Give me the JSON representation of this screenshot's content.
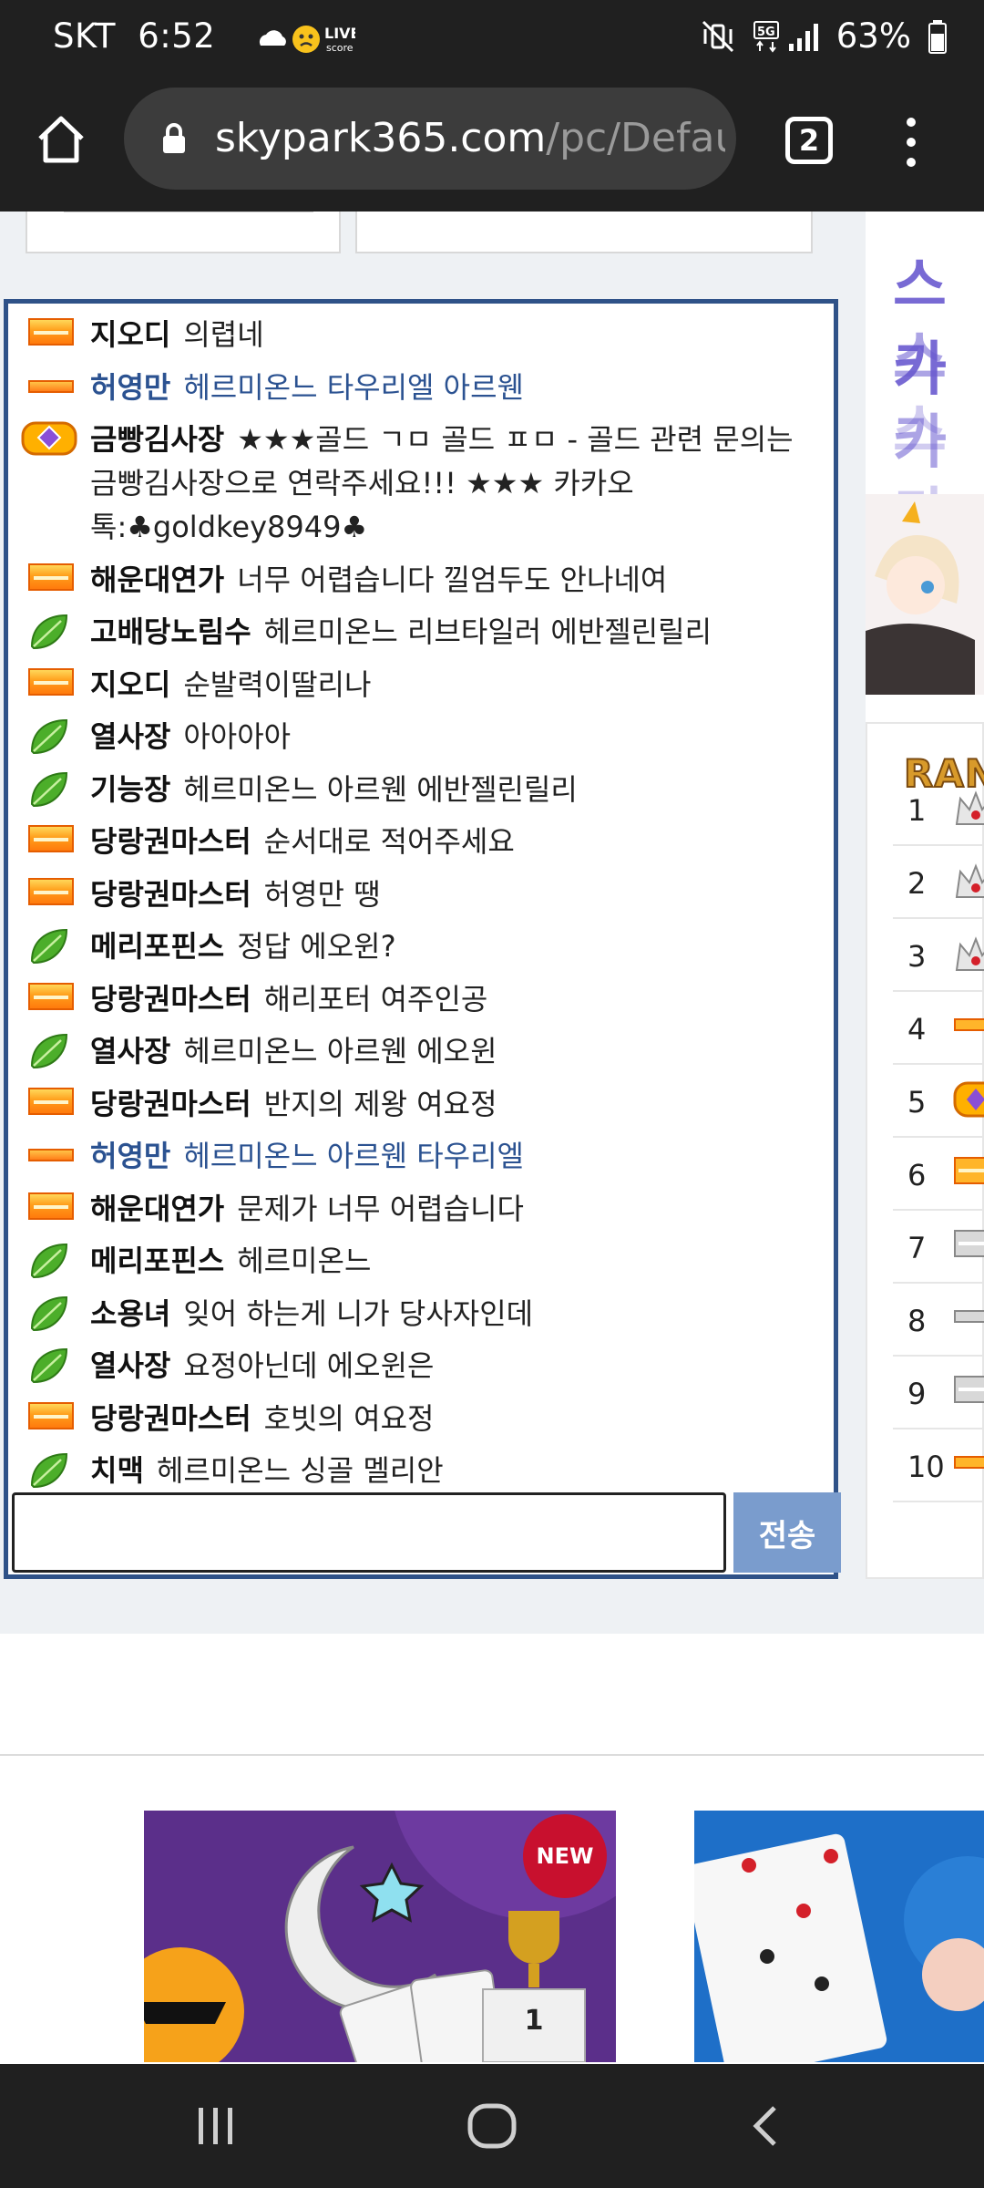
{
  "status_bar": {
    "carrier": "SKT",
    "time": "6:52",
    "live_label": "LIVE",
    "live_sub": "score",
    "network": "5G",
    "battery": "63%"
  },
  "browser": {
    "url_host": "skypark365.com",
    "url_path": "/pc/Defaul",
    "tab_count": "2"
  },
  "chat": {
    "messages": [
      {
        "badge": "gold",
        "nick": "지오디",
        "text": "의렵네"
      },
      {
        "badge": "thin",
        "nick": "허영만",
        "text": "헤르미온느 타우리엘 아르웬",
        "style": "blue"
      },
      {
        "badge": "crown",
        "nick": "금빵김사장",
        "text": "★★★골드 ㄱㅁ 골드 ㅍㅁ - 골드 관련 문의는 금빵김사장으로 연락주세요!!! ★★★ 카카오톡:♣goldkey8949♣"
      },
      {
        "badge": "gold",
        "nick": "해운대연가",
        "text": "너무 어렵습니다 낄엄두도 안나네여"
      },
      {
        "badge": "leaf",
        "nick": "고배당노림수",
        "text": "헤르미온느 리브타일러 에반젤린릴리"
      },
      {
        "badge": "gold",
        "nick": "지오디",
        "text": "순발력이딸리나"
      },
      {
        "badge": "leaf",
        "nick": "열사장",
        "text": "아아아아"
      },
      {
        "badge": "leaf",
        "nick": "기능장",
        "text": "헤르미온느 아르웬 에반젤린릴리"
      },
      {
        "badge": "gold",
        "nick": "당랑권마스터",
        "text": "순서대로 적어주세요"
      },
      {
        "badge": "gold",
        "nick": "당랑권마스터",
        "text": "허영만 땡"
      },
      {
        "badge": "leaf",
        "nick": "메리포핀스",
        "text": "정답 에오윈?"
      },
      {
        "badge": "gold",
        "nick": "당랑권마스터",
        "text": "해리포터 여주인공"
      },
      {
        "badge": "leaf",
        "nick": "열사장",
        "text": "헤르미온느 아르웬 에오윈"
      },
      {
        "badge": "gold",
        "nick": "당랑권마스터",
        "text": "반지의 제왕 여요정"
      },
      {
        "badge": "thin",
        "nick": "허영만",
        "text": "헤르미온느 아르웬 타우리엘",
        "style": "blue"
      },
      {
        "badge": "gold",
        "nick": "해운대연가",
        "text": "문제가 너무 어렵습니다"
      },
      {
        "badge": "leaf",
        "nick": "메리포핀스",
        "text": "헤르미온느"
      },
      {
        "badge": "leaf",
        "nick": "소용녀",
        "text": "잊어 하는게 니가 당사자인데"
      },
      {
        "badge": "leaf",
        "nick": "열사장",
        "text": "요정아닌데 에오윈은"
      },
      {
        "badge": "gold",
        "nick": "당랑권마스터",
        "text": "호빗의 여요정"
      },
      {
        "badge": "leaf",
        "nick": "치맥",
        "text": "헤르미온느 싱골 멜리안"
      }
    ],
    "input_value": "",
    "send_label": "전송"
  },
  "sidebar": {
    "banner_text": "스카",
    "ranking_title": "RAN",
    "ranks": [
      {
        "num": "1",
        "badge": "silver-crown"
      },
      {
        "num": "2",
        "badge": "silver-crown"
      },
      {
        "num": "3",
        "badge": "silver-crown"
      },
      {
        "num": "4",
        "badge": "thin"
      },
      {
        "num": "5",
        "badge": "crown"
      },
      {
        "num": "6",
        "badge": "gold"
      },
      {
        "num": "7",
        "badge": "silver"
      },
      {
        "num": "8",
        "badge": "silver-thin"
      },
      {
        "num": "9",
        "badge": "silver"
      },
      {
        "num": "10",
        "badge": "thin"
      }
    ]
  },
  "games": {
    "new_label": "NEW"
  },
  "colors": {
    "chat_border": "#2f5288",
    "blue_nick": "#2b5291",
    "send_button": "#7a9ccd",
    "badge_gold": "#ff9e1b",
    "leaf_green": "#4cae2a"
  }
}
